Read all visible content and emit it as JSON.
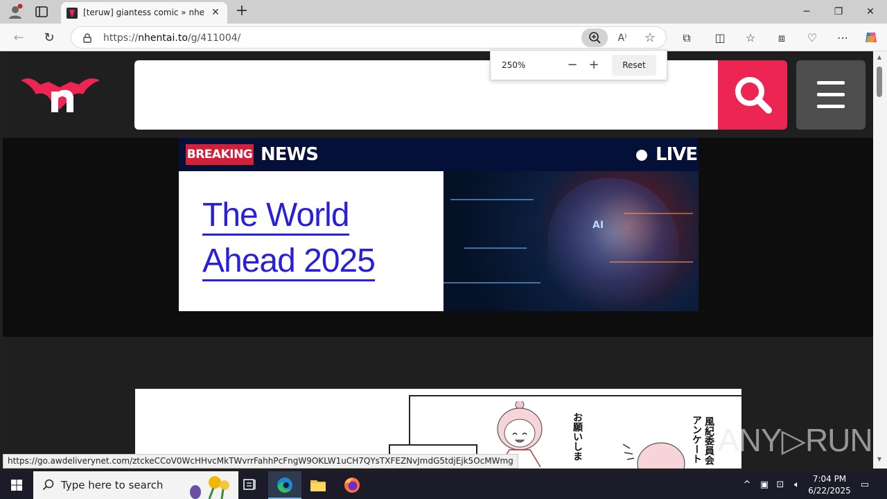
{
  "browser": {
    "tab_title": "[teruw] giantess comic » nhentai: hentai doujinshi and manga",
    "url_prefix": "https://",
    "url_domain": "nhentai.to",
    "url_path": "/g/411004/",
    "zoom": {
      "percent": "250%",
      "reset_label": "Reset"
    },
    "status_url": "https://go.awdeliverynet.com/ztckeCCoV0WcHHvcMkTWvrrFahhPcFngW9OKLW1uCH7QYsTXFEZNvJmdG5tdjEjk5OcMWmg"
  },
  "page": {
    "ad": {
      "breaking": "BREAKING",
      "news": "NEWS",
      "live": "LIVE",
      "headline_line1": "The World",
      "headline_line2": "Ahead 2025",
      "image_label": "AI"
    },
    "cover": {
      "jp_text_1": "お願いしま",
      "jp_text_2": "風紀委員会",
      "jp_text_3": "アンケート"
    }
  },
  "watermark": "ANY▷RUN",
  "taskbar": {
    "search_placeholder": "Type here to search",
    "time": "7:04 PM",
    "date": "6/22/2025"
  },
  "colors": {
    "brand": "#ed2553",
    "ad_headline": "#2a1fd8",
    "ad_header": "#051038"
  }
}
